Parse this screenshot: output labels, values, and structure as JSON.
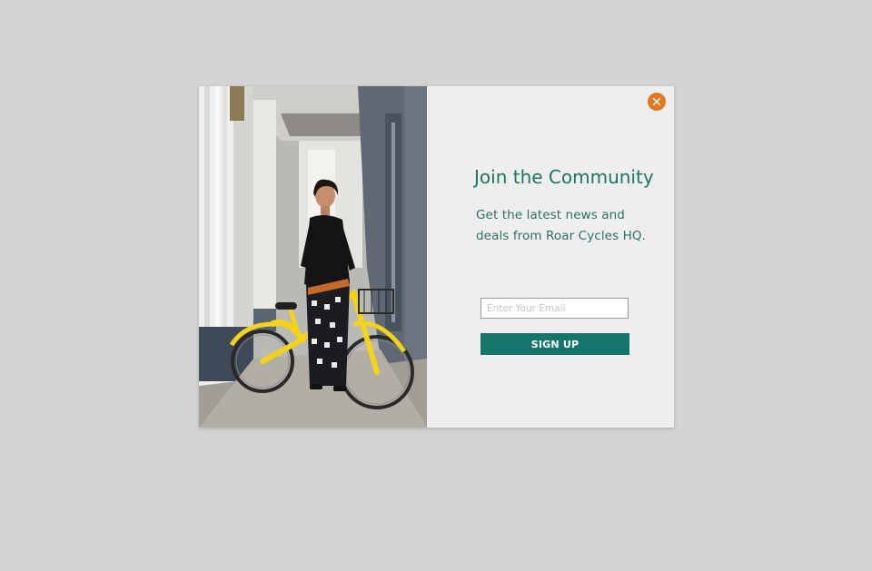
{
  "popup": {
    "heading": "Join the Community",
    "subtext_line1": "Get the latest news and",
    "subtext_line2": "deals from Roar Cycles HQ.",
    "email_placeholder": "Enter Your Email",
    "email_value": "",
    "signup_label": "SIGN UP",
    "close_icon": "close-icon"
  },
  "colors": {
    "backdrop": "#d3d3d3",
    "panel": "#efeeee",
    "accent_green": "#15756a",
    "close_orange": "#e07a22"
  },
  "image": {
    "subject": "woman-with-yellow-bicycle-photo"
  }
}
